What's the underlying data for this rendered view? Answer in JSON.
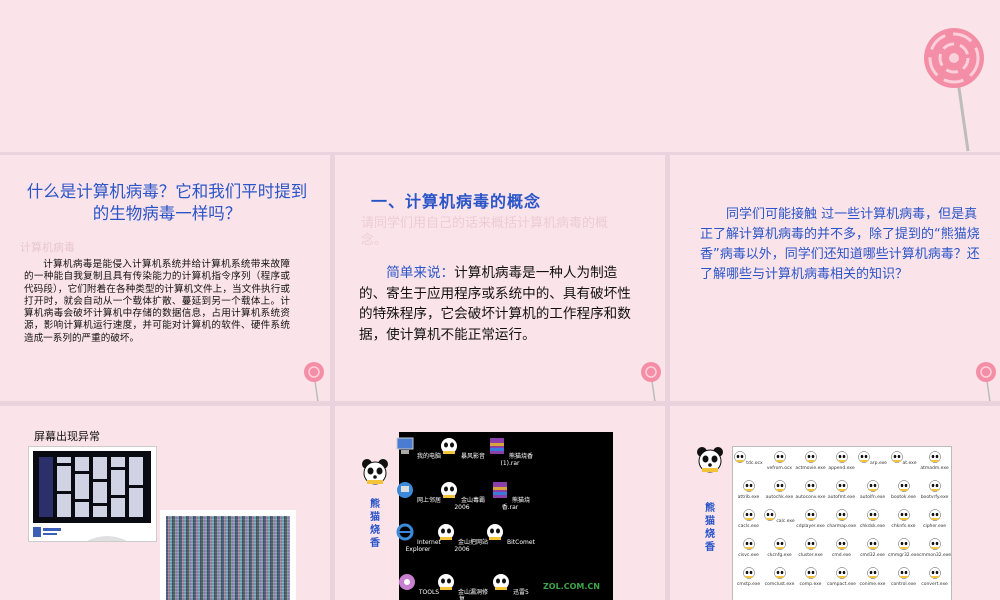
{
  "slide1": {
    "title": "什么是计算机病毒？它和我们平时提到的生物病毒一样吗？",
    "faint": "计算机病毒",
    "body": "计算机病毒是能侵入计算机系统并给计算机系统带来故障的一种能自我复制且具有传染能力的计算机指令序列（程序或代码段），它们附着在各种类型的计算机文件上，当文件执行或打开时，就会自动从一个载体扩散、蔓延到另一个载体上。计算机病毒会破坏计算机中存储的数据信息，占用计算机系统资源，影响计算机运行速度，并可能对计算机的软件、硬件系统造成一系列的严重的破坏。"
  },
  "slide2": {
    "heading": "一、计算机病毒的概念",
    "faint": "请同学们用自己的话来概括计算机病毒的概念。",
    "lead": "简单来说：",
    "body": "计算机病毒是一种人为制造的、寄生于应用程序或系统中的、具有破坏性的特殊程序，它会破坏计算机的工作程序和数据，使计算机不能正常运行。"
  },
  "slide3": {
    "body": "同学们可能接触 过一些计算机病毒，但是真正了解计算机病毒的并不多，除了提到的“熊猫烧香”病毒以外，同学们还知道哪些计算机病毒？还了解哪些与计算机病毒相关的知识？"
  },
  "slide4": {
    "caption": "屏幕出现异常"
  },
  "slide5": {
    "label": "熊猫烧香",
    "icons": [
      "我的电脑",
      "暴风影音",
      "熊猫烧香(1).rar",
      "网上邻居",
      "金山毒霸 2006",
      "熊猫烧香.rar",
      "Internet Explorer",
      "金山把网站 2006",
      "BitComet",
      "TOOLS",
      "金山漏洞修复",
      "迅雷5"
    ],
    "watermark": "ZOL.COM.CN"
  },
  "slide6": {
    "label": "熊猫烧香",
    "files": [
      "tdc.ocx",
      "vefrom.ocx",
      "actmovie.exe",
      "append.exe",
      "arp.exe",
      "at.exe",
      "atmadm.exe",
      "attrib.exe",
      "autochk.exe",
      "autoconv.exe",
      "autofmt.exe",
      "autolfn.exe",
      "bootok.exe",
      "bootvrfy.exe",
      "cacls.exe",
      "calc.exe",
      "cdplayer.exe",
      "charmap.exe",
      "chkdsk.exe",
      "chknfs.exe",
      "cipher.exe",
      "cisvc.exe",
      "ckcnfg.exe",
      "cluster.exe",
      "cmd.exe",
      "cmd32.exe",
      "cmmgr32.exe",
      "cmmon32.exe",
      "cmstp.exe",
      "comclust.exe",
      "comp.exe",
      "compact.exe",
      "conime.exe",
      "control.exe",
      "convert.exe"
    ]
  }
}
